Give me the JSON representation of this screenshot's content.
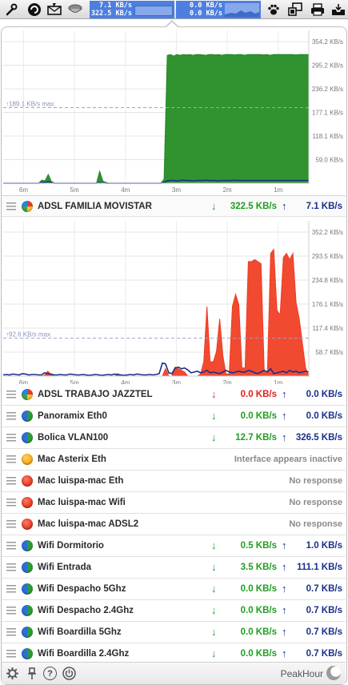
{
  "menubar": {
    "icons": [
      "wrench-icon",
      "swirl-icon",
      "mail-bolt-icon",
      "cup-icon"
    ],
    "meter1": {
      "up": "7.1 KB/s",
      "down": "322.5 KB/s"
    },
    "meter2": {
      "up": "0.0 KB/s",
      "down": "0.0 KB/s"
    },
    "right_icons": [
      "paw-icon",
      "network-monitor-icon",
      "printer-icon",
      "tray-icon"
    ]
  },
  "chart_data": [
    {
      "type": "area",
      "x_labels": [
        "6m",
        "5m",
        "4m",
        "3m",
        "2m",
        "1m"
      ],
      "y_ticks": [
        "354.2 KB/s",
        "295.2 KB/s",
        "236.2 KB/s",
        "177.1 KB/s",
        "118.1 KB/s",
        "59.0 KB/s"
      ],
      "ylim": [
        0,
        354.2
      ],
      "max_label": "↑189.1 KB/s max.",
      "series": [
        {
          "color": "#1e8a1e",
          "values": [
            0,
            0,
            0,
            0,
            0,
            0,
            0,
            0,
            0,
            0,
            0,
            0,
            8,
            6,
            22,
            4,
            0,
            0,
            0,
            0,
            0,
            0,
            0,
            0,
            0,
            0,
            0,
            0,
            0,
            0,
            30,
            5,
            2,
            0,
            0,
            0,
            0,
            0,
            0,
            0,
            0,
            0,
            0,
            0,
            0,
            0,
            0,
            0,
            0,
            0,
            10,
            320,
            322,
            318,
            322,
            320,
            322,
            321,
            322,
            320,
            322,
            322,
            321,
            320,
            322,
            322,
            321,
            322,
            320,
            322,
            322,
            322,
            321,
            322,
            322,
            320,
            322,
            322,
            322,
            322,
            322,
            321,
            322,
            320,
            322,
            322,
            322,
            322,
            322,
            322,
            322,
            321,
            322,
            322,
            322,
            322
          ]
        },
        {
          "color": "#1a2f8a",
          "values": [
            0,
            0,
            0,
            0,
            0,
            0,
            0,
            0,
            0,
            0,
            0,
            0,
            2,
            2,
            4,
            2,
            0,
            0,
            0,
            0,
            0,
            0,
            0,
            0,
            0,
            0,
            0,
            0,
            0,
            0,
            2,
            1,
            0,
            0,
            0,
            0,
            0,
            0,
            0,
            0,
            0,
            0,
            0,
            0,
            0,
            0,
            0,
            0,
            0,
            0,
            2,
            6,
            7,
            7,
            6,
            7,
            8,
            7,
            7,
            6,
            7,
            7,
            7,
            8,
            7,
            7,
            7,
            6,
            7,
            7,
            7,
            7,
            8,
            7,
            7,
            7,
            7,
            7,
            7,
            7,
            7,
            7,
            7,
            7,
            7,
            7,
            7,
            7,
            7,
            7,
            7,
            7,
            7,
            7,
            7,
            7
          ]
        }
      ]
    },
    {
      "type": "area",
      "x_labels": [
        "6m",
        "5m",
        "4m",
        "3m",
        "2m",
        "1m"
      ],
      "y_ticks": [
        "352.2 KB/s",
        "293.5 KB/s",
        "234.8 KB/s",
        "176.1 KB/s",
        "117.4 KB/s",
        "58.7 KB/s"
      ],
      "ylim": [
        0,
        352.2
      ],
      "max_label": "↑92.6 KB/s max.",
      "series": [
        {
          "color": "#f03b20",
          "values": [
            0,
            0,
            0,
            0,
            0,
            0,
            0,
            0,
            0,
            0,
            0,
            0,
            0,
            2,
            12,
            4,
            0,
            0,
            0,
            0,
            0,
            0,
            0,
            0,
            0,
            0,
            0,
            0,
            0,
            0,
            0,
            0,
            0,
            0,
            0,
            0,
            6,
            0,
            0,
            0,
            0,
            0,
            0,
            0,
            0,
            0,
            0,
            0,
            0,
            0,
            0,
            18,
            0,
            0,
            22,
            18,
            14,
            10,
            0,
            0,
            0,
            0,
            5,
            35,
            170,
            35,
            35,
            60,
            140,
            50,
            5,
            5,
            170,
            200,
            175,
            20,
            20,
            280,
            280,
            285,
            280,
            275,
            10,
            10,
            300,
            310,
            160,
            150,
            290,
            300,
            285,
            300,
            180,
            140,
            80,
            20,
            0
          ]
        },
        {
          "color": "#1a2f8a",
          "values": [
            3,
            4,
            3,
            5,
            4,
            3,
            6,
            5,
            3,
            4,
            4,
            3,
            3,
            8,
            6,
            5,
            3,
            3,
            4,
            3,
            3,
            5,
            4,
            3,
            3,
            4,
            3,
            2,
            3,
            4,
            3,
            2,
            3,
            4,
            3,
            5,
            4,
            3,
            2,
            3,
            4,
            3,
            5,
            4,
            3,
            3,
            4,
            3,
            4,
            6,
            32,
            30,
            8,
            6,
            20,
            22,
            18,
            20,
            15,
            8,
            10,
            12,
            8,
            10,
            14,
            8,
            10,
            8,
            6,
            10,
            14,
            10,
            8,
            10,
            12,
            10,
            10,
            14,
            12,
            8,
            6,
            10,
            14,
            10,
            18,
            6,
            8,
            10,
            12,
            8,
            14,
            10,
            12,
            8,
            10,
            12,
            10
          ]
        }
      ]
    }
  ],
  "rows": [
    {
      "name": "ADSL FAMILIA MOVISTAR",
      "down": "322.5 KB/s",
      "up": "7.1 KB/s",
      "dot": "multi"
    },
    {
      "name": "ADSL TRABAJO JAZZTEL",
      "down": "0.0 KB/s",
      "up": "0.0 KB/s",
      "dot": "multi",
      "red": true
    },
    {
      "name": "Panoramix Eth0",
      "down": "0.0 KB/s",
      "up": "0.0 KB/s",
      "dot": "greenblue"
    },
    {
      "name": "Bolica VLAN100",
      "down": "12.7 KB/s",
      "up": "326.5 KB/s",
      "dot": "greenblue"
    },
    {
      "name": "Mac Asterix Eth",
      "status": "Interface appears inactive",
      "dot": "orange"
    },
    {
      "name": "Mac luispa-mac Eth",
      "status": "No response",
      "dot": "red"
    },
    {
      "name": "Mac luispa-mac Wifi",
      "status": "No response",
      "dot": "red"
    },
    {
      "name": "Mac luispa-mac ADSL2",
      "status": "No response",
      "dot": "red"
    },
    {
      "name": "Wifi Dormitorio",
      "down": "0.5 KB/s",
      "up": "1.0 KB/s",
      "dot": "greenblue"
    },
    {
      "name": "Wifi Entrada",
      "down": "3.5 KB/s",
      "up": "111.1 KB/s",
      "dot": "greenblue"
    },
    {
      "name": "Wifi Despacho 5Ghz",
      "down": "0.0 KB/s",
      "up": "0.7 KB/s",
      "dot": "greenblue"
    },
    {
      "name": "Wifi Despacho 2.4Ghz",
      "down": "0.0 KB/s",
      "up": "0.7 KB/s",
      "dot": "greenblue"
    },
    {
      "name": "Wifi Boardilla 5Ghz",
      "down": "0.0 KB/s",
      "up": "0.7 KB/s",
      "dot": "greenblue"
    },
    {
      "name": "Wifi Boardilla 2.4Ghz",
      "down": "0.0 KB/s",
      "up": "0.7 KB/s",
      "dot": "greenblue"
    }
  ],
  "arrows": {
    "down": "↓",
    "up": "↑"
  },
  "footer": {
    "brand": "PeakHour",
    "help": "?",
    "icons": [
      "gear-icon",
      "pin-icon",
      "help-icon",
      "power-icon"
    ]
  }
}
